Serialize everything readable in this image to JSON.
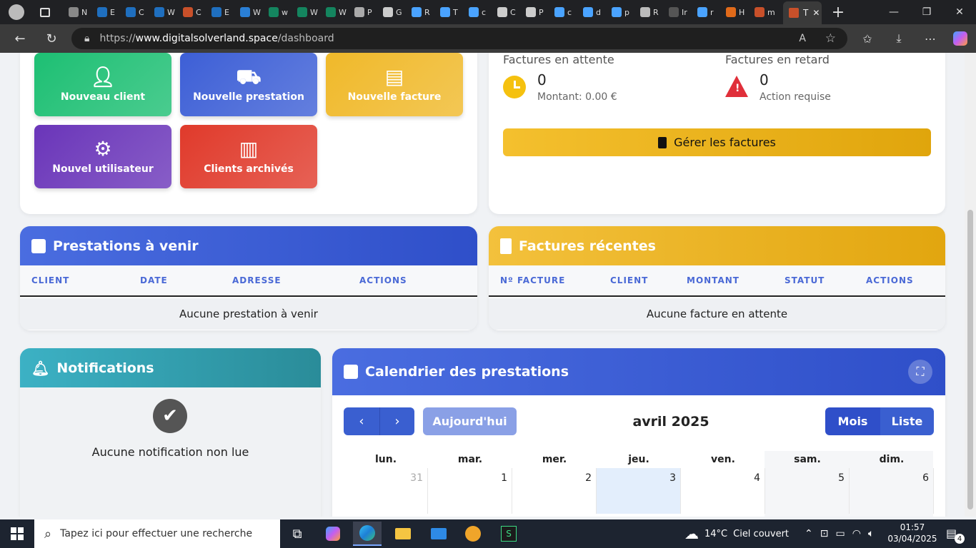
{
  "browser": {
    "tabs": [
      "N",
      "E",
      "C",
      "W",
      "C",
      "E",
      "W",
      "w",
      "W",
      "W",
      "P",
      "G",
      "R",
      "T",
      "c",
      "C",
      "P",
      "c",
      "d",
      "p",
      "R",
      "Ir",
      "r",
      "H",
      "m"
    ],
    "active_tab_label": "T",
    "url_prefix": "https://",
    "url_host": "www.digitalsolverland.space",
    "url_path": "/dashboard"
  },
  "quick_actions": [
    {
      "label": "Nouveau client",
      "icon": "user-plus-icon",
      "color": "#1dbf73"
    },
    {
      "label": "Nouvelle prestation",
      "icon": "dolly-icon",
      "color": "#3d5fd6"
    },
    {
      "label": "Nouvelle facture",
      "icon": "invoice-icon",
      "color": "#f0b92a"
    },
    {
      "label": "Nouvel utilisateur",
      "icon": "user-gear-icon",
      "color": "#6a35b9"
    },
    {
      "label": "Clients archivés",
      "icon": "archive-icon",
      "color": "#e03a2b"
    }
  ],
  "invoices": {
    "pending_label": "Factures en attente",
    "pending_count": "0",
    "pending_amount": "Montant: 0.00 €",
    "late_label": "Factures en retard",
    "late_count": "0",
    "late_sub": "Action requise",
    "manage_button": "Gérer les factures"
  },
  "upcoming": {
    "title": "Prestations à venir",
    "columns": [
      "CLIENT",
      "DATE",
      "ADRESSE",
      "ACTIONS"
    ],
    "empty": "Aucune prestation à venir"
  },
  "recent_invoices": {
    "title": "Factures récentes",
    "columns": [
      "Nº FACTURE",
      "CLIENT",
      "MONTANT",
      "STATUT",
      "ACTIONS"
    ],
    "empty": "Aucune facture en attente"
  },
  "notifications": {
    "title": "Notifications",
    "empty": "Aucune notification non lue"
  },
  "calendar": {
    "title": "Calendrier des prestations",
    "today_button": "Aujourd'hui",
    "month_label": "avril 2025",
    "view_month": "Mois",
    "view_list": "Liste",
    "weekdays": [
      "lun.",
      "mar.",
      "mer.",
      "jeu.",
      "ven.",
      "sam.",
      "dim."
    ],
    "first_week": [
      "31",
      "1",
      "2",
      "3",
      "4",
      "5",
      "6"
    ]
  },
  "taskbar": {
    "search_placeholder": "Tapez ici pour effectuer une recherche",
    "temperature": "14°C",
    "weather": "Ciel couvert",
    "time": "01:57",
    "date": "03/04/2025",
    "notif_count": "4"
  }
}
